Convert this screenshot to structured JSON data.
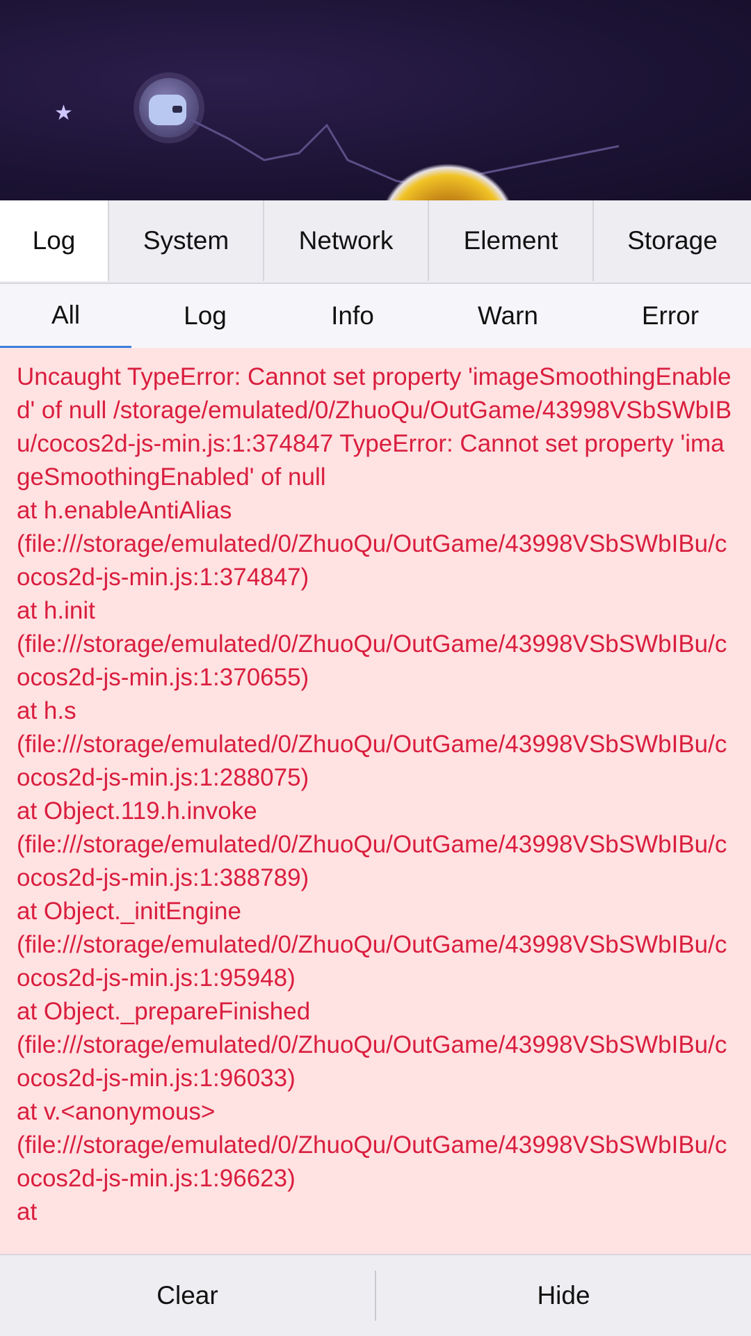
{
  "top_tabs": [
    {
      "label": "Log",
      "active": true
    },
    {
      "label": "System",
      "active": false
    },
    {
      "label": "Network",
      "active": false
    },
    {
      "label": "Element",
      "active": false
    },
    {
      "label": "Storage",
      "active": false
    }
  ],
  "sub_tabs": [
    {
      "label": "All",
      "active": true
    },
    {
      "label": "Log",
      "active": false
    },
    {
      "label": "Info",
      "active": false
    },
    {
      "label": "Warn",
      "active": false
    },
    {
      "label": "Error",
      "active": false
    }
  ],
  "log": {
    "entry_text": "Uncaught TypeError: Cannot set property 'imageSmoothingEnabled' of null /storage/emulated/0/ZhuoQu/OutGame/43998VSbSWbIBu/cocos2d-js-min.js:1:374847 TypeError: Cannot set property 'imageSmoothingEnabled' of null\nat h.enableAntiAlias\n(file:///storage/emulated/0/ZhuoQu/OutGame/43998VSbSWbIBu/cocos2d-js-min.js:1:374847)\nat h.init\n(file:///storage/emulated/0/ZhuoQu/OutGame/43998VSbSWbIBu/cocos2d-js-min.js:1:370655)\nat h.s\n(file:///storage/emulated/0/ZhuoQu/OutGame/43998VSbSWbIBu/cocos2d-js-min.js:1:288075)\nat Object.119.h.invoke\n(file:///storage/emulated/0/ZhuoQu/OutGame/43998VSbSWbIBu/cocos2d-js-min.js:1:388789)\nat Object._initEngine\n(file:///storage/emulated/0/ZhuoQu/OutGame/43998VSbSWbIBu/cocos2d-js-min.js:1:95948)\nat Object._prepareFinished\n(file:///storage/emulated/0/ZhuoQu/OutGame/43998VSbSWbIBu/cocos2d-js-min.js:1:96033)\nat v.<anonymous>\n(file:///storage/emulated/0/ZhuoQu/OutGame/43998VSbSWbIBu/cocos2d-js-min.js:1:96623)\nat",
    "color": "#d91e3e",
    "background": "#ffe2e2"
  },
  "bottom": {
    "clear_label": "Clear",
    "hide_label": "Hide"
  },
  "colors": {
    "active_tab_underline": "#3b7ddd",
    "tab_bar_bg": "#ededf2"
  }
}
